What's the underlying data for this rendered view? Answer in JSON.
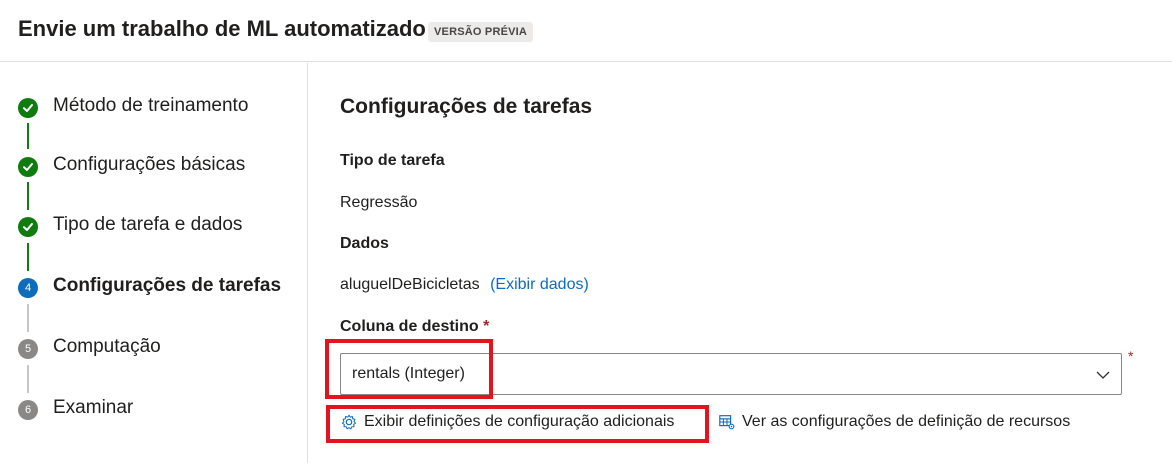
{
  "header": {
    "title": "Envie um trabalho de ML automatizado",
    "badge": "VERSÃO PRÉVIA"
  },
  "steps": [
    {
      "label": "Método de treinamento",
      "state": "done",
      "marker": ""
    },
    {
      "label": "Configurações básicas",
      "state": "done",
      "marker": ""
    },
    {
      "label": "Tipo de tarefa e dados",
      "state": "done",
      "marker": ""
    },
    {
      "label": "Configurações de tarefas",
      "state": "current",
      "marker": "4"
    },
    {
      "label": "Computação",
      "state": "pending",
      "marker": "5"
    },
    {
      "label": "Examinar",
      "state": "pending",
      "marker": "6"
    }
  ],
  "main": {
    "title": "Configurações de tarefas",
    "task_type_label": "Tipo de tarefa",
    "task_type_value": "Regressão",
    "data_label": "Dados",
    "data_value": "aluguelDeBicicletas",
    "data_link": "(Exibir dados)",
    "target_label": "Coluna de destino",
    "required_mark": "*",
    "target_value": "rentals (Integer)",
    "additional_settings": "Exibir definições de configuração adicionais",
    "featurization_settings": "Ver as configurações de definição de recursos"
  },
  "icons": {
    "step_done": "checkmark-icon",
    "dropdown": "chevron-down-icon",
    "settings": "gear-icon",
    "featurization": "table-settings-icon"
  },
  "colors": {
    "done": "#107c10",
    "current": "#0f6cbd",
    "pending": "#8a8886",
    "link": "#0f6cbd",
    "highlight": "#e3141f",
    "required": "#a4262c"
  }
}
